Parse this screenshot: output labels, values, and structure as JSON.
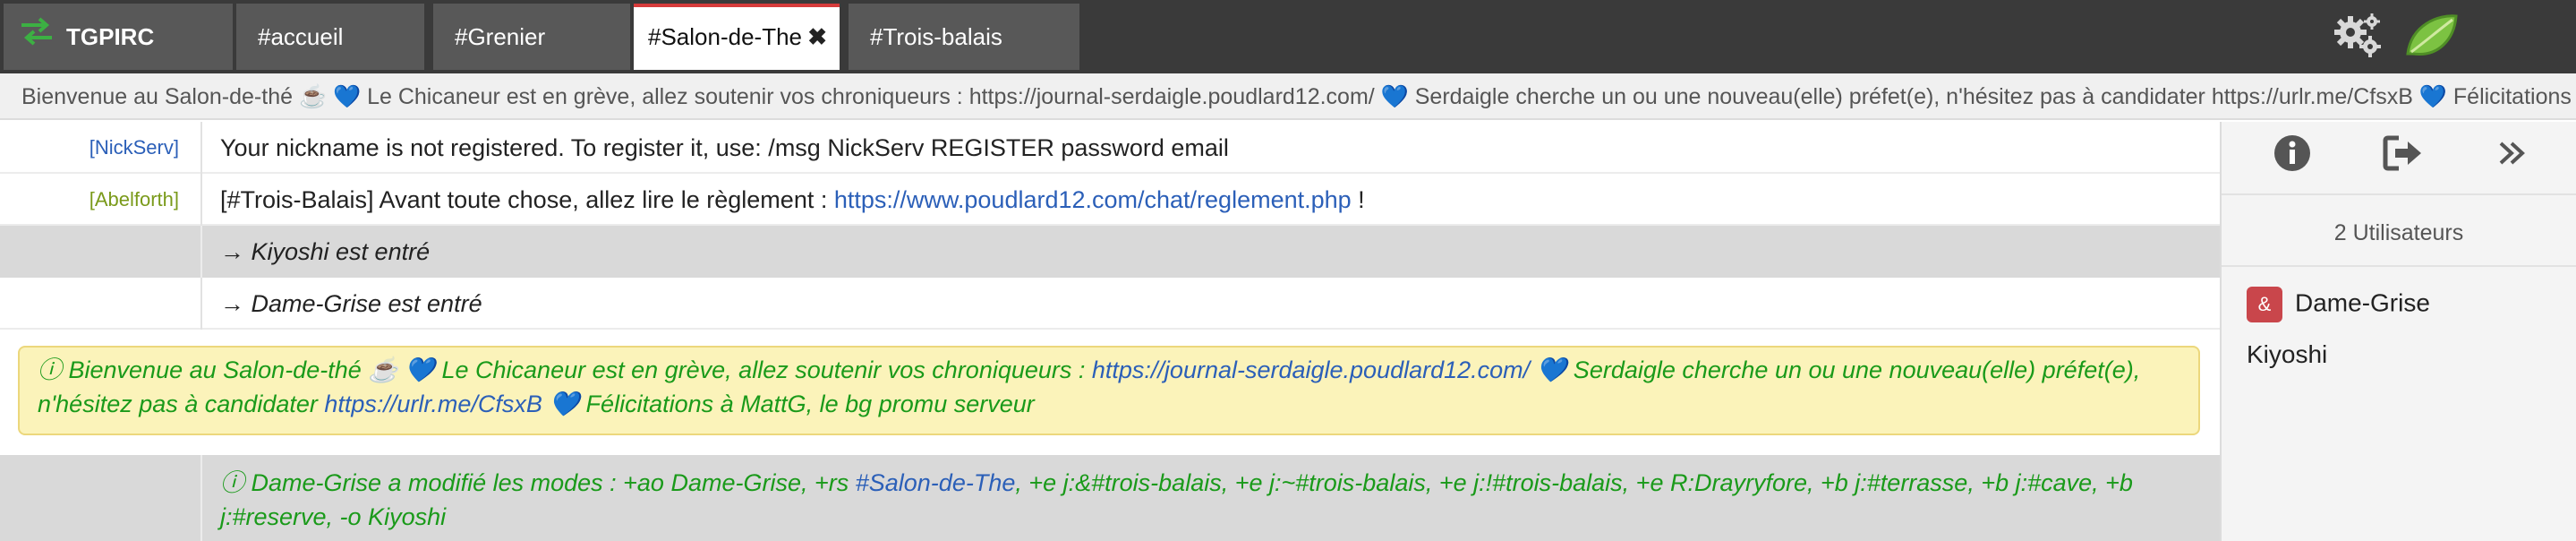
{
  "tabs": [
    {
      "label": "TGPIRC",
      "icon": "swap-arrows-icon"
    },
    {
      "label": "#accueil"
    },
    {
      "label": "#Grenier"
    },
    {
      "label": "#Salon-de-The",
      "active": true
    },
    {
      "label": "#Trois-balais"
    }
  ],
  "toolbar": {
    "settings_icon": "gears-icon",
    "logo_icon": "leaf-logo-icon"
  },
  "topic": "Bienvenue au Salon-de-thé ☕ 💙 Le Chicaneur est en grève, allez soutenir vos chroniqueurs : https://journal-serdaigle.poudlard12.com/ 💙 Serdaigle cherche un ou une nouveau(elle) préfet(e), n'hésitez pas à candidater https://urlr.me/CfsxB 💙 Félicitations",
  "messages": {
    "m1": {
      "nick": "[NickServ]",
      "text": "Your nickname is not registered. To register it, use: /msg NickServ REGISTER password email"
    },
    "m2": {
      "nick": "[Abelforth]",
      "text_before": "[#Trois-Balais] Avant toute chose, allez lire le règlement : ",
      "link": "https://www.poudlard12.com/chat/reglement.php",
      "text_after": " !"
    },
    "m3": {
      "text": "→ Kiyoshi est entré"
    },
    "m4": {
      "text": "→ Dame-Grise est entré"
    },
    "notice": {
      "part1": "ⓘ Bienvenue au Salon-de-thé ☕ 💙 Le Chicaneur est en grève, allez soutenir vos chroniqueurs : ",
      "link1": "https://journal-serdaigle.poudlard12.com/",
      "part2": " 💙 Serdaigle cherche un ou une nouveau(elle) préfet(e), n'hésitez pas à candidater ",
      "link2": "https://urlr.me/CfsxB",
      "part3": " 💙 Félicitations à MattG, le bg promu serveur"
    },
    "modes": {
      "part1": "ⓘ Dame-Grise a modifié les modes : +ao Dame-Grise, +rs ",
      "link": "#Salon-de-The",
      "part2": ", +e j:&#trois-balais, +e j:~#trois-balais, +e j:!#trois-balais, +e R:Drayryfore, +b j:#terrasse, +b j:#cave, +b j:#reserve, -o Kiyoshi"
    }
  },
  "sidebar": {
    "icons": [
      "info-icon",
      "leave-channel-icon",
      "collapse-icon"
    ],
    "user_count": "2 Utilisateurs",
    "users": [
      {
        "badge": "&",
        "name": "Dame-Grise"
      },
      {
        "name": "Kiyoshi"
      }
    ]
  },
  "colors": {
    "topbar": "#3a3a3a",
    "tab": "#585858",
    "active_tab_accent": "#d63b3b",
    "nick_nickserv": "#2b5fb8",
    "nick_abelforth": "#7a9a1a",
    "event_green": "#1a9a1a",
    "link_blue": "#2b5fb8",
    "notice_bg": "#fbf3ba",
    "badge_red": "#c9464b",
    "brand_icon_green": "#3cb043"
  }
}
